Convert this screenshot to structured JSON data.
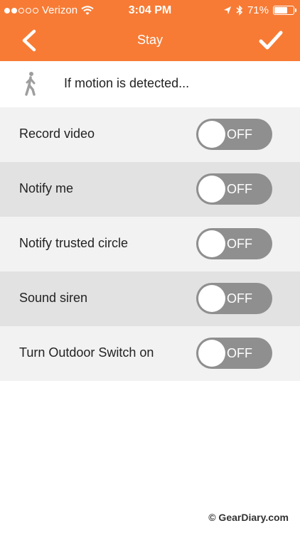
{
  "status_bar": {
    "carrier": "Verizon",
    "time": "3:04 PM",
    "battery_percent": "71%",
    "battery_level": 0.71,
    "signal_bars_filled": 2,
    "signal_bars_total": 5
  },
  "nav": {
    "title": "Stay",
    "back_icon": "chevron-left-icon",
    "confirm_icon": "checkmark-icon"
  },
  "trigger": {
    "icon": "walking-person-icon",
    "text": "If motion is detected..."
  },
  "settings": [
    {
      "label": "Record video",
      "state": "OFF"
    },
    {
      "label": "Notify me",
      "state": "OFF"
    },
    {
      "label": "Notify trusted circle",
      "state": "OFF"
    },
    {
      "label": "Sound siren",
      "state": "OFF"
    },
    {
      "label": "Turn Outdoor Switch on",
      "state": "OFF"
    }
  ],
  "footer": {
    "watermark": "© GearDiary.com"
  },
  "colors": {
    "header": "#f77b35",
    "toggle_off": "#8f8f8f",
    "row_light": "#f2f2f2",
    "row_dark": "#e2e2e2"
  }
}
